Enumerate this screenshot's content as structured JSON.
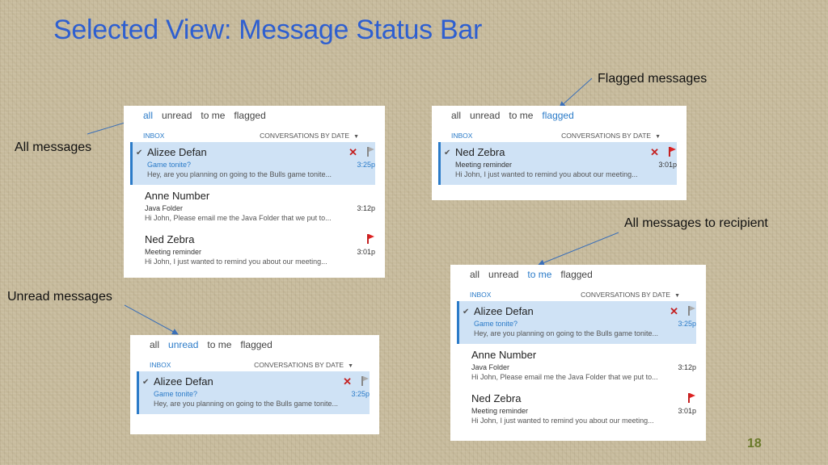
{
  "slide": {
    "title": "Selected View: Message Status Bar",
    "number": "18"
  },
  "labels": {
    "all_messages": "All messages",
    "flagged_messages": "Flagged messages",
    "unread_messages": "Unread messages",
    "to_recipient": "All messages to recipient"
  },
  "filters": [
    "all",
    "unread",
    "to me",
    "flagged"
  ],
  "inbox_label": "INBOX",
  "sort_label": "CONVERSATIONS BY DATE",
  "messages": {
    "alizee": {
      "sender": "Alizee Defan",
      "subject": "Game tonite?",
      "preview": "Hey, are you planning on going to the Bulls game tonite...",
      "time": "3:25p"
    },
    "anne": {
      "sender": "Anne Number",
      "subject": "Java Folder",
      "preview": "Hi John, Please email me the Java Folder that we put to...",
      "time": "3:12p"
    },
    "ned": {
      "sender": "Ned Zebra",
      "subject": "Meeting reminder",
      "preview": "Hi John, I just wanted to remind you about our meeting...",
      "time": "3:01p"
    }
  },
  "colors": {
    "title": "#2e5fd0",
    "accent": "#2b7bc8",
    "selected_row": "#cfe2f5",
    "flag_red": "#c42121"
  }
}
